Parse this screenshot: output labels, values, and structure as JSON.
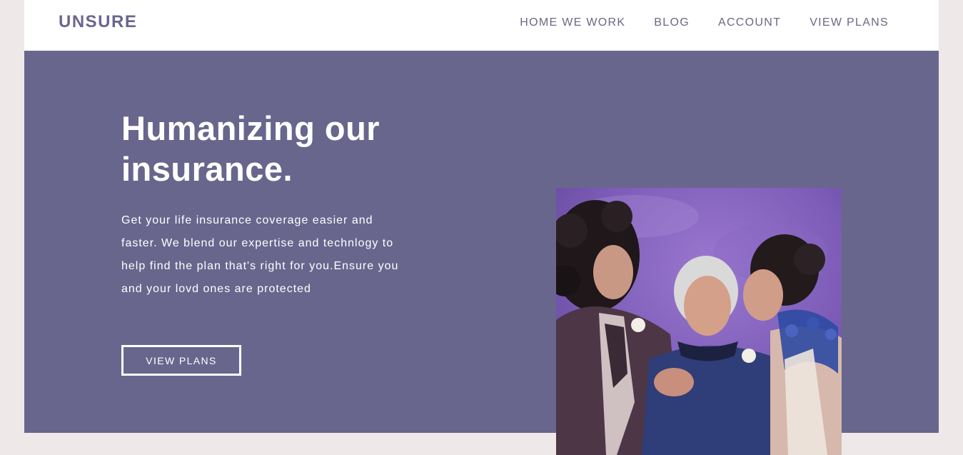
{
  "brand": {
    "name": "UNSURE"
  },
  "nav": {
    "items": [
      {
        "label": "HOME WE WORK"
      },
      {
        "label": "BLOG"
      },
      {
        "label": "ACCOUNT"
      },
      {
        "label": "VIEW PLANS"
      }
    ]
  },
  "hero": {
    "headline": "Humanizing our insurance.",
    "description": "Get your life insurance coverage easier and faster. We blend our expertise and technlogy to help find the plan that's right for you.Ensure you and your lovd ones are protected",
    "cta_label": "VIEW PLANS"
  },
  "colors": {
    "page_background": "#efe8e8",
    "navbar_background": "#ffffff",
    "brand_text": "#6a6690",
    "nav_text": "#6b6885",
    "hero_background": "#69668d",
    "hero_text": "#ffffff",
    "photo_backdrop": "#7c5cb4"
  }
}
